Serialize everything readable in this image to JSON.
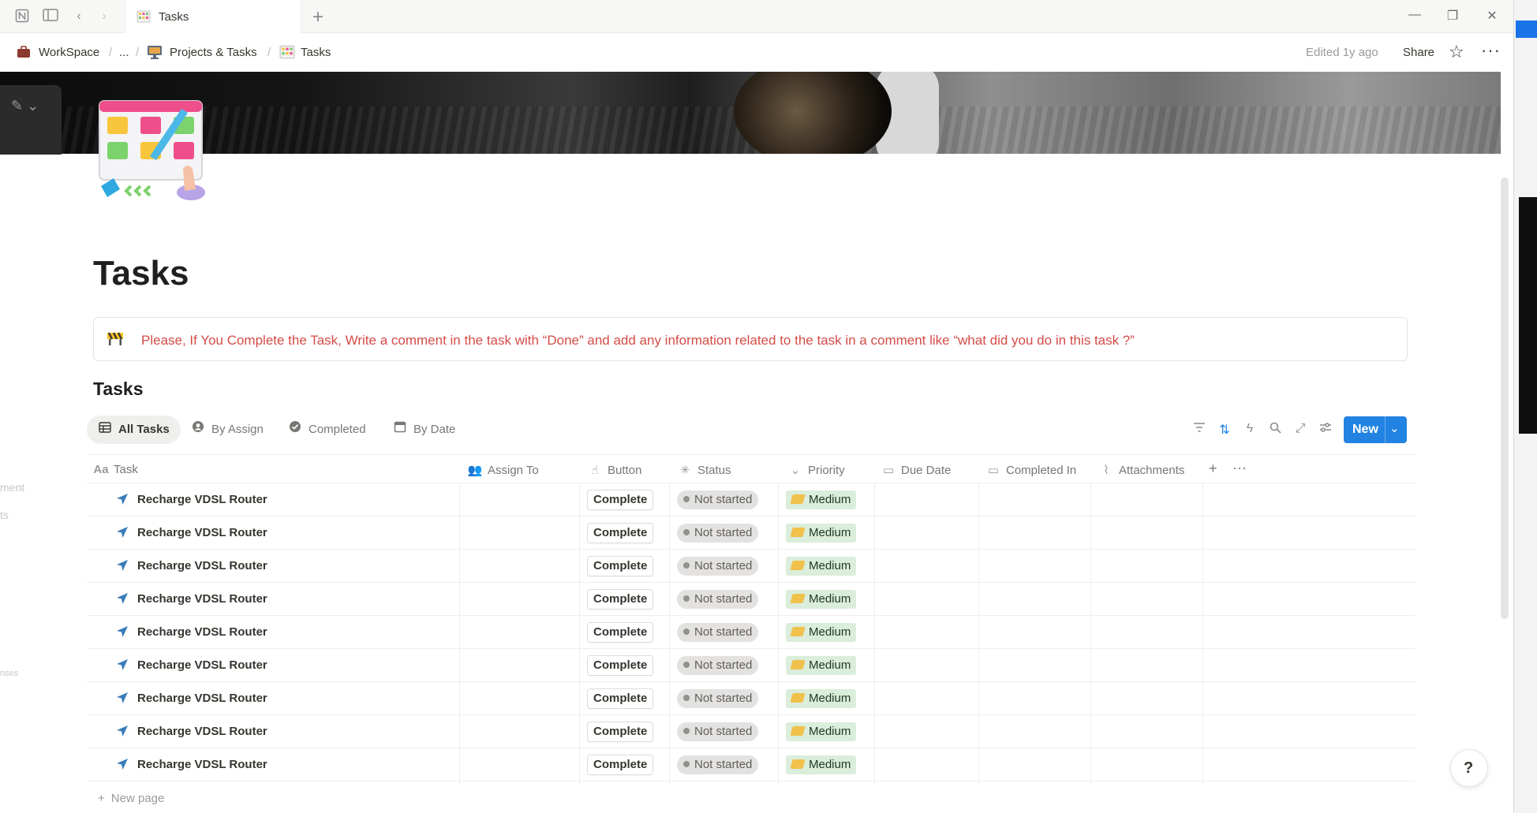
{
  "window": {
    "tab_title": "Tasks",
    "new_tab": "+",
    "controls": {
      "minimize": "—",
      "restore": "❐",
      "close": "✕"
    }
  },
  "breadcrumb": {
    "items": [
      {
        "label": "WorkSpace",
        "icon": "briefcase-icon"
      },
      {
        "label": "...",
        "icon": ""
      },
      {
        "label": "Projects & Tasks",
        "icon": "monitor-icon"
      },
      {
        "label": "Tasks",
        "icon": "kanban-icon"
      }
    ],
    "separator": "/"
  },
  "topbar": {
    "edited": "Edited 1y ago",
    "share": "Share",
    "star": "☆",
    "more": "···"
  },
  "page": {
    "title": "Tasks",
    "callout": "Please, If You Complete the Task, Write a comment in the task with “Done” and add any information related to the task in a comment like “what did you do in this task ?”",
    "database_title": "Tasks"
  },
  "views": [
    {
      "label": "All Tasks",
      "icon": "table-icon",
      "active": true
    },
    {
      "label": "By Assign",
      "icon": "person-icon",
      "active": false
    },
    {
      "label": "Completed",
      "icon": "check-circle-icon",
      "active": false
    },
    {
      "label": "By Date",
      "icon": "calendar-icon",
      "active": false
    }
  ],
  "toolbar": {
    "new_label": "New"
  },
  "columns": [
    {
      "label": "Task",
      "icon": "Aa"
    },
    {
      "label": "Assign To",
      "icon": "people-icon"
    },
    {
      "label": "Button",
      "icon": "cursor-icon"
    },
    {
      "label": "Status",
      "icon": "loader-icon"
    },
    {
      "label": "Priority",
      "icon": "chevron-circle-icon"
    },
    {
      "label": "Due Date",
      "icon": "calendar-icon"
    },
    {
      "label": "Completed In",
      "icon": "calendar-icon"
    },
    {
      "label": "Attachments",
      "icon": "paperclip-icon"
    }
  ],
  "add_column": "+",
  "column_more": "···",
  "rows": [
    {
      "task": "Recharge VDSL Router",
      "assign": "",
      "button": "Complete",
      "status": "Not started",
      "priority": "Medium"
    },
    {
      "task": "Recharge VDSL Router",
      "assign": "",
      "button": "Complete",
      "status": "Not started",
      "priority": "Medium"
    },
    {
      "task": "Recharge VDSL Router",
      "assign": "",
      "button": "Complete",
      "status": "Not started",
      "priority": "Medium"
    },
    {
      "task": "Recharge VDSL Router",
      "assign": "",
      "button": "Complete",
      "status": "Not started",
      "priority": "Medium"
    },
    {
      "task": "Recharge VDSL Router",
      "assign": "",
      "button": "Complete",
      "status": "Not started",
      "priority": "Medium"
    },
    {
      "task": "Recharge VDSL Router",
      "assign": "",
      "button": "Complete",
      "status": "Not started",
      "priority": "Medium"
    },
    {
      "task": "Recharge VDSL Router",
      "assign": "",
      "button": "Complete",
      "status": "Not started",
      "priority": "Medium"
    },
    {
      "task": "Recharge VDSL Router",
      "assign": "",
      "button": "Complete",
      "status": "Not started",
      "priority": "Medium"
    },
    {
      "task": "Recharge VDSL Router",
      "assign": "",
      "button": "Complete",
      "status": "Not started",
      "priority": "Medium"
    }
  ],
  "new_page": "New page",
  "ghost_sidebar": {
    "line1": "ment",
    "line2": "ts",
    "line3": "nses"
  },
  "colors": {
    "accent": "#2383e2",
    "callout_text": "#d44c47",
    "priority_bg": "#dbeddb",
    "status_bg": "#e3e2e0"
  }
}
